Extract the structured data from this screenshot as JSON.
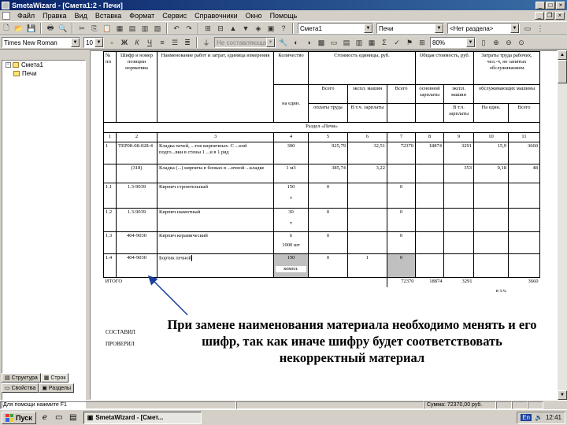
{
  "window": {
    "title": "SmetaWizard - [Смета1:2 - Печи]"
  },
  "menu": [
    "Файл",
    "Правка",
    "Вид",
    "Вставка",
    "Формат",
    "Сервис",
    "Справочники",
    "Окно",
    "Помощь"
  ],
  "toolbar1": {
    "estimate_combo": "Смета1",
    "section_combo": "Печи",
    "subsection_combo": "<Нет раздела>"
  },
  "toolbar2": {
    "font_combo": "Times New Roman",
    "size_combo": "10",
    "bold_label": "Ж",
    "italic_label": "К",
    "underline_label": "Ч",
    "norm_combo": "Не составляющая",
    "zoom_combo": "80%"
  },
  "tree": {
    "root": "Смета1",
    "child": "Печи"
  },
  "tabs": {
    "row1": [
      "Структура",
      "Строк"
    ],
    "row2": [
      "Свойства",
      "Разделы"
    ]
  },
  "estimate": {
    "header": {
      "num": "№ пп",
      "code": "Шифр и номер позиции норматива",
      "name": "Наименование работ и затрат, единица измерения",
      "qty": "Количество",
      "unit_cost": "Стоимость единицы, руб.",
      "total_cost": "Общая стоимость, руб.",
      "labor": "Затраты труда рабочих, чел.-ч, не занятых обслуживанием",
      "per_unit": "на един.",
      "total": "Всего",
      "exploit": "экспл. машин",
      "base_wage": "основной зарплаты",
      "mach": "обслуживающих машины",
      "wages": "оплаты труда",
      "incl_wage": "В т.ч. зарплаты",
      "on_unit": "На един.",
      "all": "Всего"
    },
    "section_title": "Раздел «Печи»",
    "col_numbers": [
      "1",
      "2",
      "3",
      "4",
      "5",
      "6",
      "7",
      "8",
      "9",
      "10",
      "11"
    ],
    "rows": [
      {
        "num": "1",
        "code": "ТЕР08-08-028-4",
        "name": "Кладка печей, ...тов кирпичных. С ...ной подго...вки в стены 1 ...и в 1 ряд",
        "qty": "300",
        "c5": "925,79",
        "c6": "32,51",
        "c7": "72370",
        "c8": "18874",
        "c9": "3291",
        "c10": "15,9",
        "c11": "3660"
      },
      {
        "num": "",
        "code": "(318)",
        "name": "Кладка (...) кирпича в блоках в ...ичной ...кладке",
        "qty": "1 м3",
        "c5": "385,74",
        "c6": "3,22",
        "c7": "",
        "c8": "",
        "c9": "353",
        "c10": "0,18",
        "c11": "48"
      },
      {
        "num": "1.1",
        "code": "1.3-9039",
        "name": "Кирпич строительный",
        "qty": "150",
        "unit": "т",
        "c5": "0",
        "c7": "0"
      },
      {
        "num": "1.2",
        "code": "1.3-9039",
        "name": "Кирпич шамотный",
        "qty": "30",
        "unit": "т",
        "c5": "0",
        "c7": "0"
      },
      {
        "num": "1.3",
        "code": "404-9030",
        "name": "Кирпич керамический",
        "qty": "6",
        "unit": "1000 шт",
        "c5": "0",
        "c7": "0"
      },
      {
        "num": "1.4",
        "code": "404-9030",
        "name": "Бортик печной",
        "qty": "150",
        "unit": "компл.",
        "c5": "0",
        "c6": "1",
        "c7": "0"
      }
    ],
    "total_label": "ИТОГО",
    "total": {
      "c7": "72370",
      "c8": "18874",
      "c9": "3291",
      "c11": "3660"
    },
    "vat_label": "в т.ч.",
    "composed_label": "СОСТАВИЛ",
    "checked_label": "ПРОВЕРИЛ"
  },
  "annotation": "При замене наименования материала необходимо менять и его шифр, так как иначе шифру будет соответствовать некорректный материал",
  "status": {
    "hint": "Для помощи нажмите F1",
    "sum": "Сумма: 72370,00 руб."
  },
  "taskbar": {
    "start": "Пуск",
    "task": "SmetaWizard - [Смет...",
    "tray_lang": "En",
    "clock": "12:41"
  }
}
